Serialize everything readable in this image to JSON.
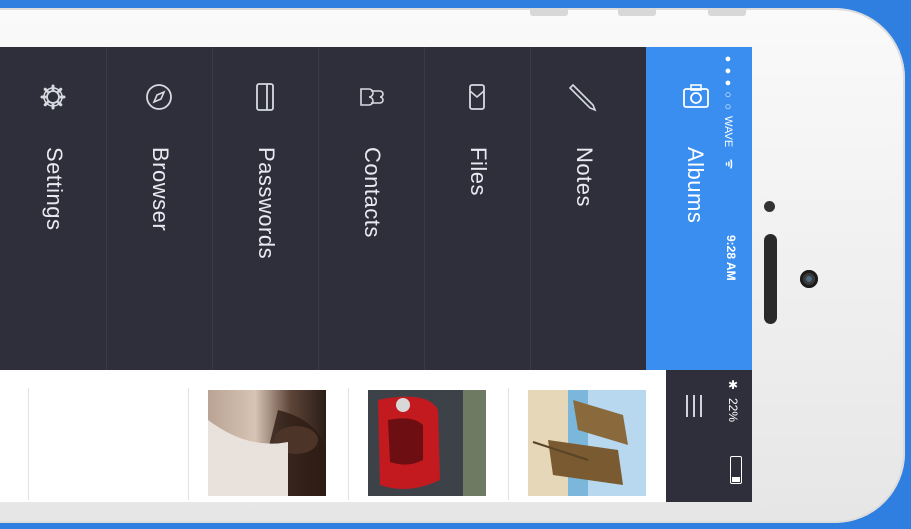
{
  "menu": {
    "items": [
      {
        "label": "Settings",
        "icon": "gear-icon"
      },
      {
        "label": "Browser",
        "icon": "compass-icon"
      },
      {
        "label": "Passwords",
        "icon": "card-icon"
      },
      {
        "label": "Contacts",
        "icon": "contacts-icon"
      },
      {
        "label": "Files",
        "icon": "folder-icon"
      },
      {
        "label": "Notes",
        "icon": "pen-icon"
      }
    ],
    "active": {
      "label": "Albums",
      "icon": "camera-icon"
    }
  },
  "status_bar": {
    "carrier": "●●●○○ WAVE",
    "wifi": "ᯤ",
    "time": "9:28 AM",
    "bluetooth": "✱",
    "battery": "22%"
  },
  "gallery": {
    "thumbnails": [
      {
        "name": "photo-woman"
      },
      {
        "name": "photo-red-car"
      },
      {
        "name": "photo-beach-umbrellas"
      }
    ]
  },
  "colors": {
    "accent": "#3a8ef0",
    "sidebar": "#2e2f3b",
    "background": "#2f7fe0"
  }
}
